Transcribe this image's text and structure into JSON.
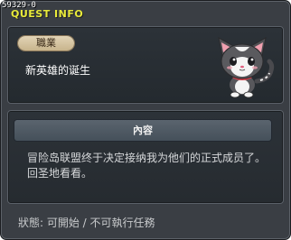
{
  "quest_window": {
    "quest_id": "59329-0",
    "title": "QUEST INFO",
    "job_label": "職業",
    "quest_name": "新英雄的诞生",
    "content_header": "內容",
    "description": "冒险岛联盟终于决定接纳我为他们的正式成员了。回圣地看看。",
    "status": "狀態: 可開始 / 不可執行任務",
    "npc_icon": "cat-pet-icon"
  }
}
